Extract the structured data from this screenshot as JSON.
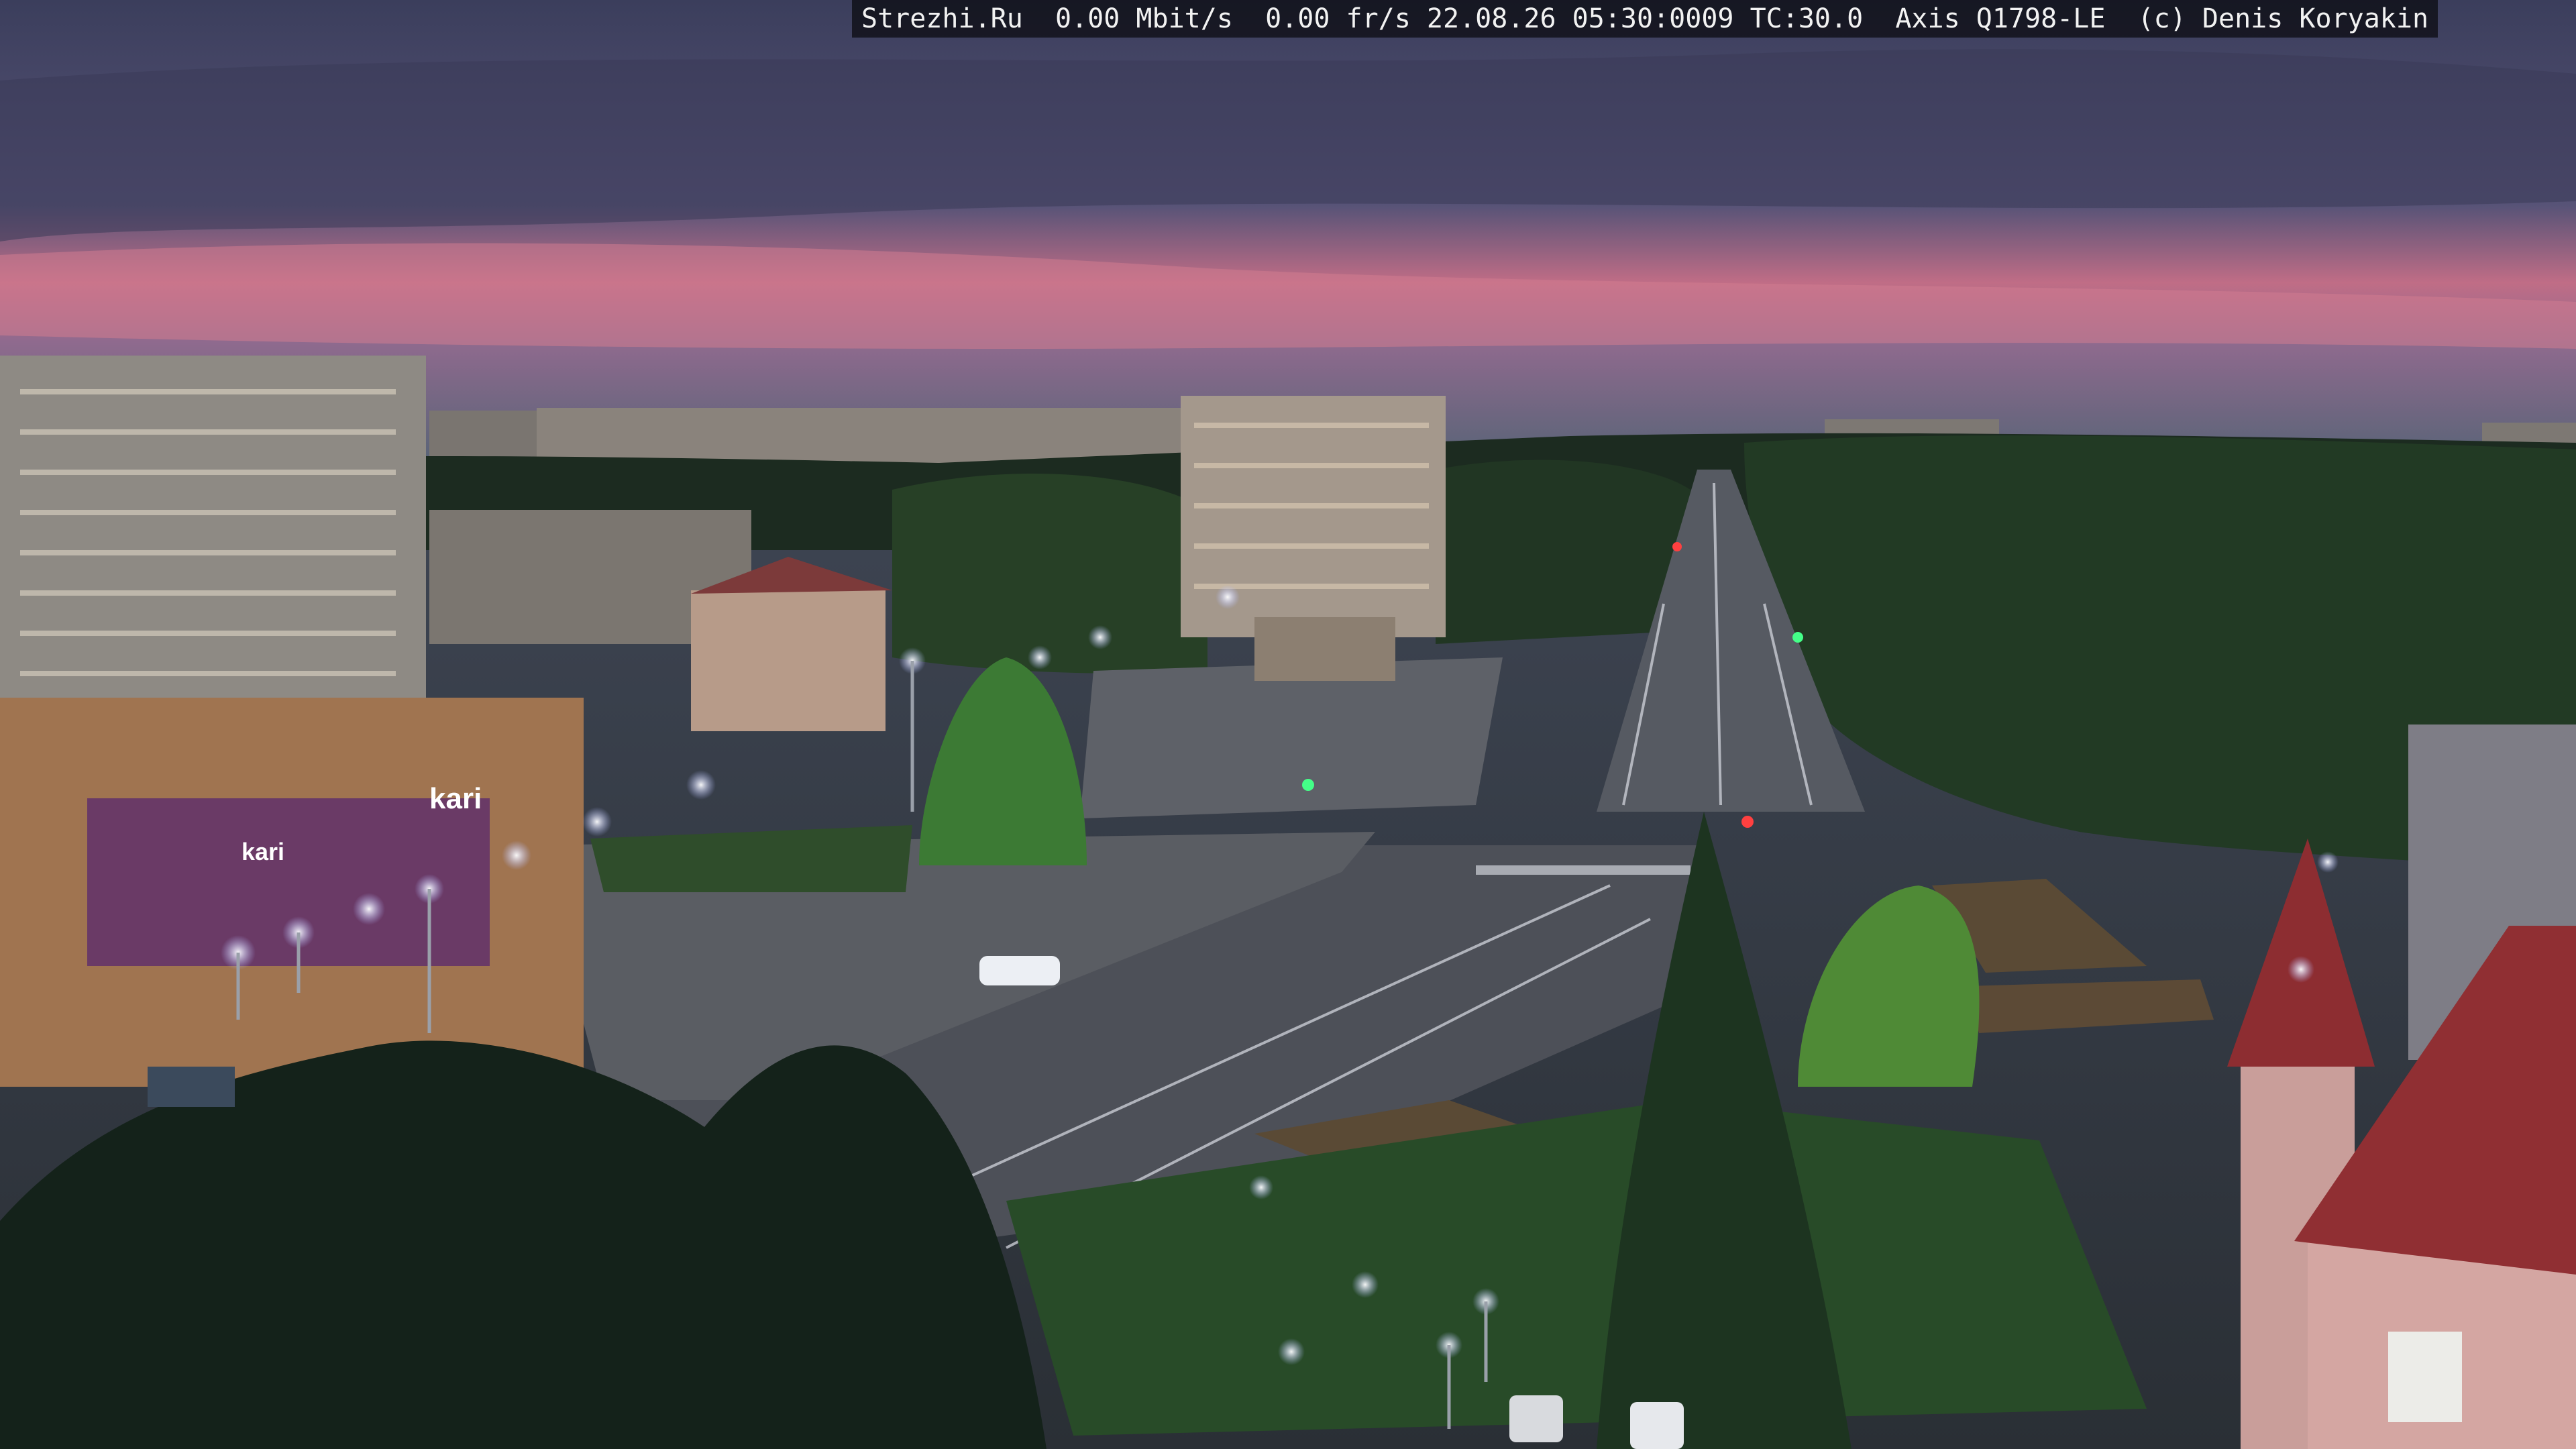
{
  "overlay": {
    "site": "Strezhi.Ru",
    "bitrate": "0.00 Mbit/s",
    "framerate": "0.00 fr/s",
    "datetime": "22.08.26 05:30:0009",
    "tc": "TC:30.0",
    "camera": "Axis Q1798-LE",
    "copyright": "(c) Denis Koryakin"
  },
  "signs": {
    "store": "kari",
    "store_small": "kari"
  },
  "colors": {
    "sky_top": "#3a3d5a",
    "sky_glow": "#c9708a",
    "road": "#4a4d55",
    "foliage": "#1f3320",
    "lamp": "#dfe4ff"
  }
}
